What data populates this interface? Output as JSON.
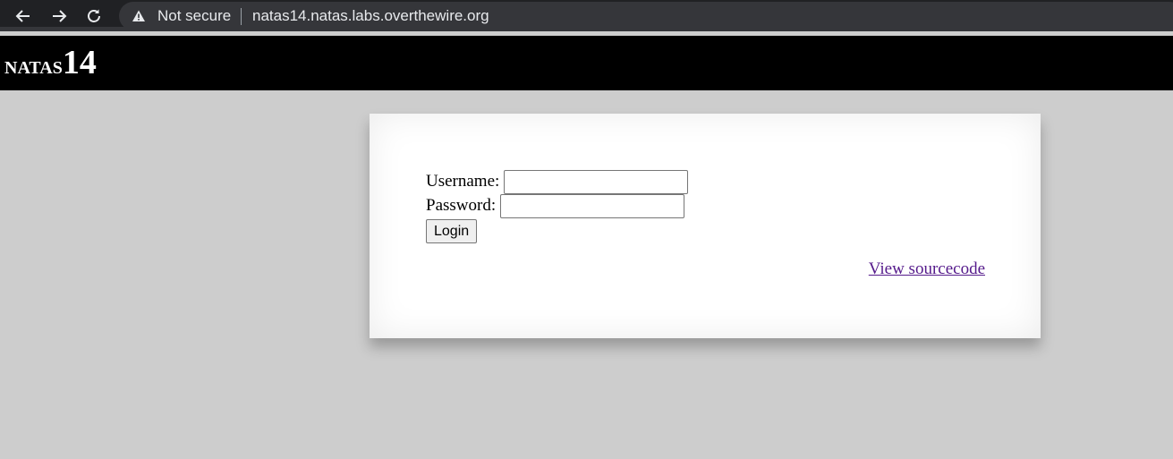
{
  "browser": {
    "security_label": "Not secure",
    "url": "natas14.natas.labs.overthewire.org",
    "icons": [
      "back-arrow-icon",
      "forward-arrow-icon",
      "reload-icon",
      "warning-icon"
    ]
  },
  "header": {
    "title_word": "natas",
    "title_number": "14"
  },
  "form": {
    "username_label": "Username:",
    "username_value": "",
    "password_label": "Password:",
    "password_value": "",
    "login_label": "Login"
  },
  "links": {
    "source_label": "View sourcecode"
  },
  "colors": {
    "page_bg": "#cdcdcd",
    "header_bg": "#000000",
    "link_visited": "#551a8b"
  }
}
